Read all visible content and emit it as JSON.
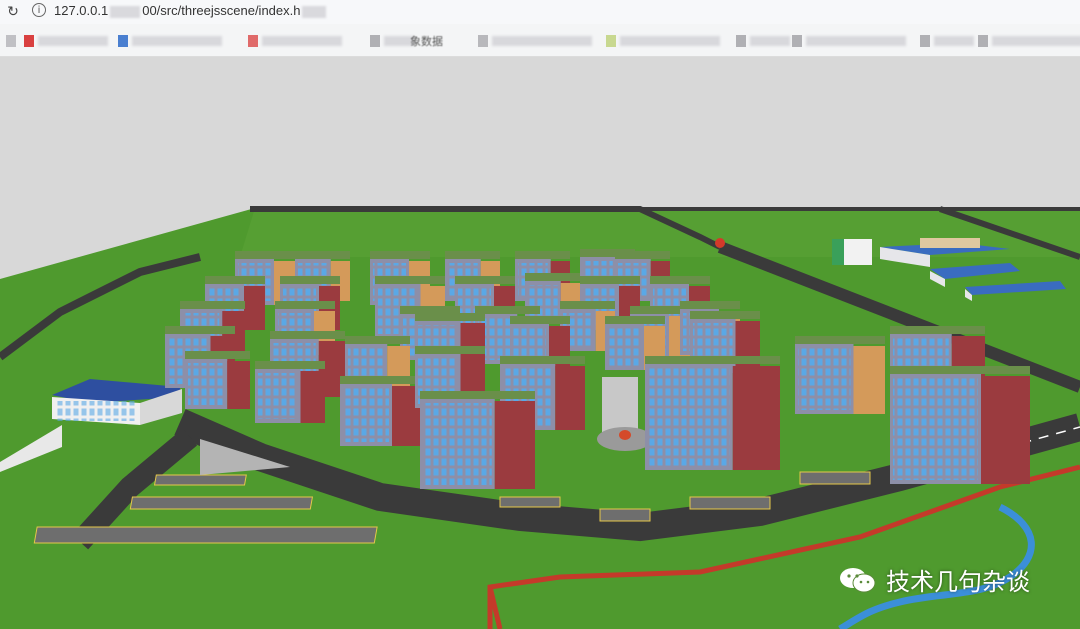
{
  "browser": {
    "reload_icon": "reload-icon",
    "site_info_icon": "info-icon",
    "url_prefix": "127.0.0.1",
    "url_suffix": "00/src/threejsscene/index.h",
    "bookmark_partial_text": "象数据"
  },
  "watermark": {
    "icon": "wechat-icon",
    "text": "技术几句杂谈"
  },
  "colors": {
    "grass": "#4f9a2e",
    "road": "#3a3a3a",
    "building_red": "#9b3b3f",
    "building_grey": "#8d8fa8",
    "building_orange": "#d49a5a",
    "window_blue": "#5aa8e6",
    "river_blue": "#3b8fd8",
    "red_path": "#c43a2a"
  }
}
